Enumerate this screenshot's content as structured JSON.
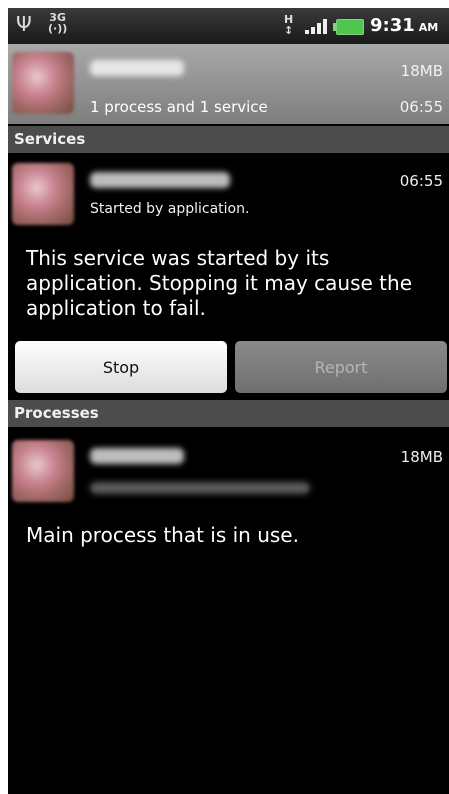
{
  "status_bar": {
    "icons": [
      "usb-icon",
      "net-3g-icon",
      "data-h-icon",
      "signal-icon",
      "battery-icon"
    ],
    "net_label": "3G",
    "net_sub": "(·))",
    "data_label": "H",
    "data_arrows": "↕",
    "time": "9:31",
    "ampm": "AM"
  },
  "app": {
    "size": "18MB",
    "summary": "1 process and 1 service",
    "time": "06:55"
  },
  "services": {
    "header": "Services",
    "time": "06:55",
    "started": "Started by application.",
    "description": "This service was started by its application. Stopping it may cause the application to fail.",
    "stop_label": "Stop",
    "report_label": "Report"
  },
  "processes": {
    "header": "Processes",
    "size": "18MB",
    "description": "Main process that is in use."
  },
  "colors": {
    "screen_bg": "#000000",
    "section_header_bg": "#4c4c4c",
    "app_header_bg": "#8f8f8f",
    "battery": "#4fc74f"
  }
}
